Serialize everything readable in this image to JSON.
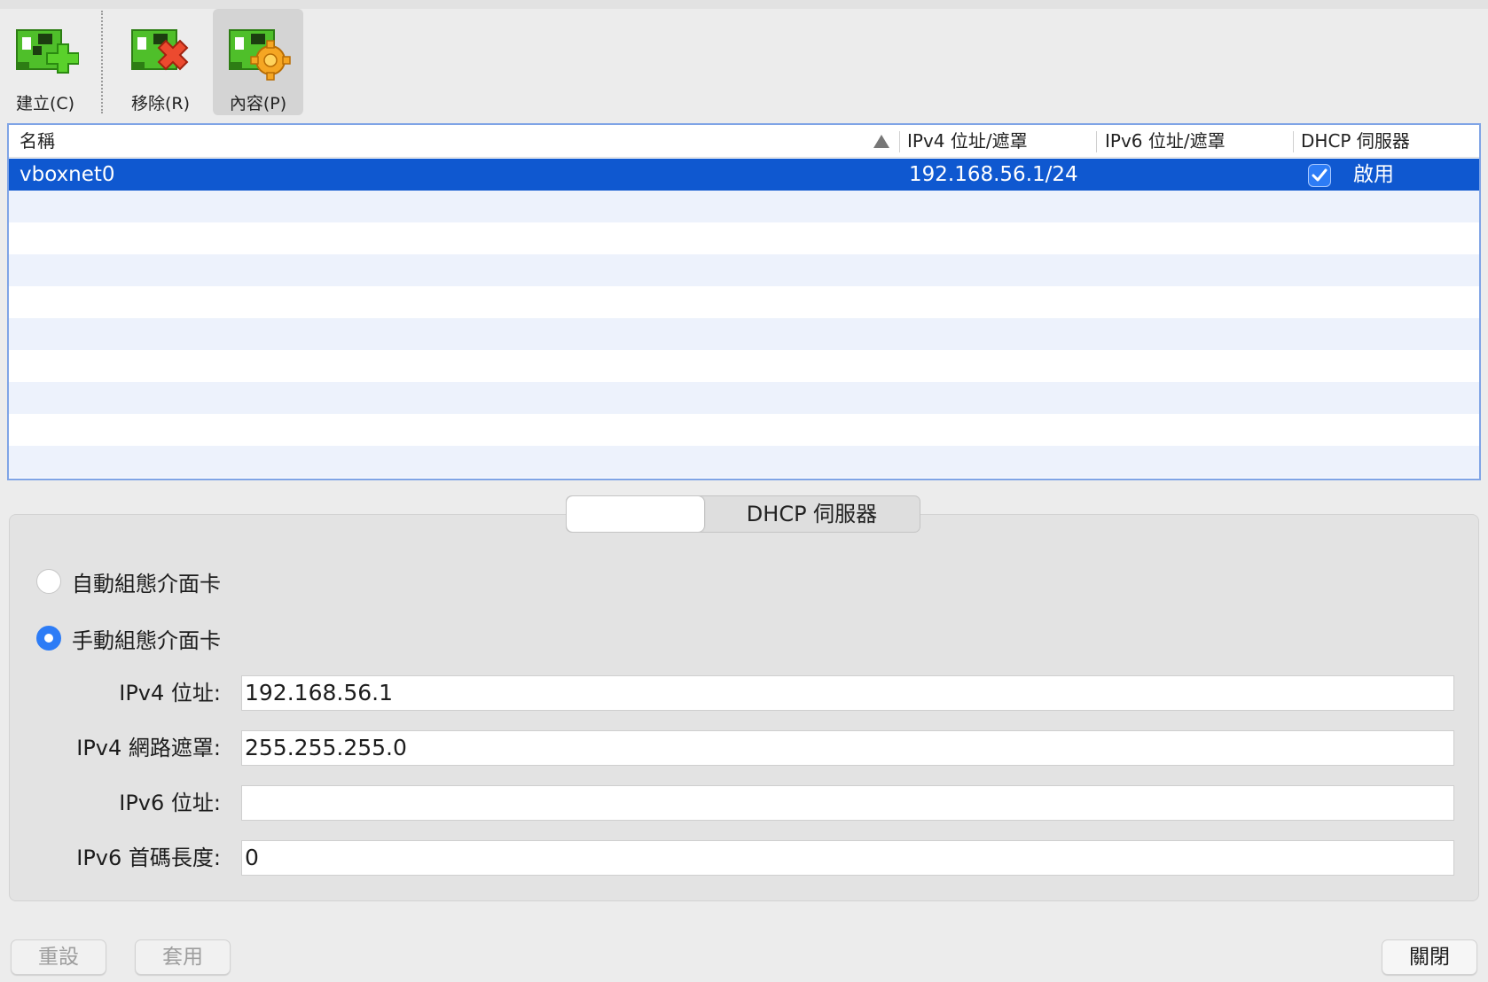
{
  "toolbar": {
    "create": {
      "label": "建立(C)",
      "icon": "create-network-icon"
    },
    "remove": {
      "label": "移除(R)",
      "icon": "remove-network-icon"
    },
    "properties": {
      "label": "內容(P)",
      "icon": "properties-network-icon"
    }
  },
  "table": {
    "headers": {
      "name": "名稱",
      "ipv4": "IPv4 位址/遮罩",
      "ipv6": "IPv6 位址/遮罩",
      "dhcp": "DHCP 伺服器"
    },
    "sort": {
      "column": "name",
      "direction": "ascending"
    },
    "rows": [
      {
        "name": "vboxnet0",
        "ipv4": "192.168.56.1/24",
        "ipv6": "",
        "dhcp_enabled": true,
        "dhcp_label": "啟用",
        "selected": true
      }
    ]
  },
  "tabs": [
    {
      "label": "",
      "active": true
    },
    {
      "label": "DHCP 伺服器",
      "active": false
    }
  ],
  "adapter": {
    "auto_label": "自動組態介面卡",
    "manual_label": "手動組態介面卡",
    "selected_mode": "manual",
    "ipv4_address_label": "IPv4 位址:",
    "ipv4_address": "192.168.56.1",
    "ipv4_mask_label": "IPv4 網路遮罩:",
    "ipv4_mask": "255.255.255.0",
    "ipv6_address_label": "IPv6 位址:",
    "ipv6_address": "",
    "ipv6_prefix_label": "IPv6 首碼長度:",
    "ipv6_prefix": "0"
  },
  "buttons": {
    "reset": "重設",
    "apply": "套用",
    "close": "關閉"
  },
  "colors": {
    "selection": "#0f58d0",
    "accent": "#2d7cf6",
    "stripe": "#edf2fc",
    "table_focus_border": "#7fa4e6"
  }
}
